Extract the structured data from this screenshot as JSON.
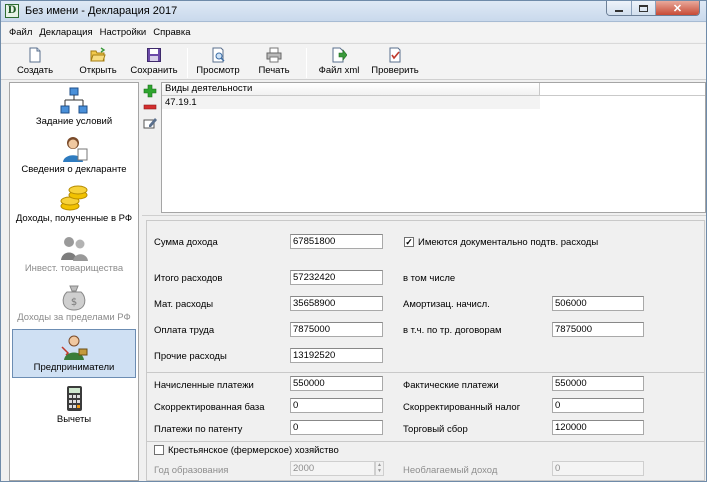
{
  "window": {
    "title": "Без имени - Декларация 2017"
  },
  "menu": [
    "Файл",
    "Декларация",
    "Настройки",
    "Справка"
  ],
  "toolbar": {
    "create": "Создать",
    "open": "Открыть",
    "save": "Сохранить",
    "preview": "Просмотр",
    "print": "Печать",
    "xml": "Файл xml",
    "check": "Проверить"
  },
  "sidebar": {
    "conditions": "Задание условий",
    "declarant": "Сведения о декларанте",
    "income_rf": "Доходы, полученные в РФ",
    "invest": "Инвест. товарищества",
    "income_abroad": "Доходы за пределами РФ",
    "entrepreneurs": "Предприниматели",
    "deductions": "Вычеты"
  },
  "activity": {
    "header": "Виды деятельности",
    "rows": [
      "47.19.1"
    ]
  },
  "form": {
    "income_label": "Сумма дохода",
    "income_value": "67851800",
    "docs_checkbox_label": "Имеются документально подтв. расходы",
    "docs_checked": "✓",
    "total_exp_label": "Итого расходов",
    "total_exp_value": "57232420",
    "including_label": "в том числе",
    "mat_label": "Мат. расходы",
    "mat_value": "35658900",
    "amort_label": "Амортизац. начисл.",
    "amort_value": "506000",
    "labor_label": "Оплата труда",
    "labor_value": "7875000",
    "labor_contracts_label": "в т.ч. по тр. договорам",
    "labor_contracts_value": "7875000",
    "other_label": "Прочие расходы",
    "other_value": "13192520",
    "accrued_label": "Начисленные платежи",
    "accrued_value": "550000",
    "actual_label": "Фактические платежи",
    "actual_value": "550000",
    "adj_base_label": "Скорректированная база",
    "adj_base_value": "0",
    "adj_tax_label": "Скорректированный налог",
    "adj_tax_value": "0",
    "patent_label": "Платежи по патенту",
    "patent_value": "0",
    "trade_label": "Торговый сбор",
    "trade_value": "120000",
    "farm_label": "Крестьянское (фермерское) хозяйство",
    "year_label": "Год образования",
    "year_value": "2000",
    "untaxed_label": "Необлагаемый доход",
    "untaxed_value": "0"
  }
}
